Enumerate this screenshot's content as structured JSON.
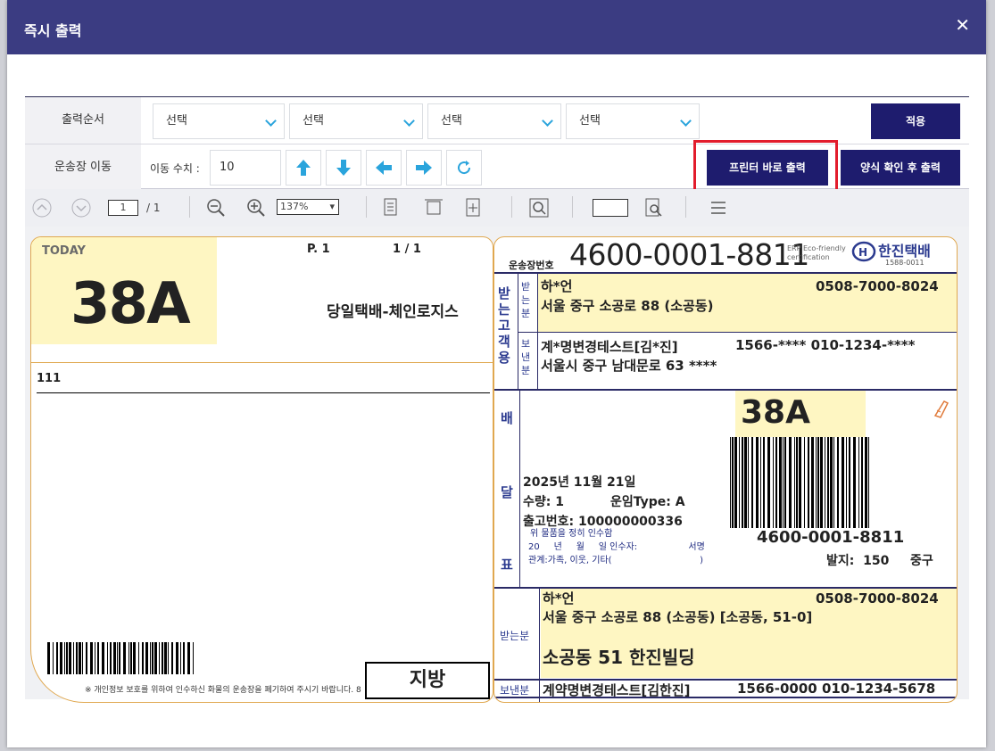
{
  "dialog": {
    "title": "즉시 출력"
  },
  "options": {
    "order_label": "출력순서",
    "selects": [
      "선택",
      "선택",
      "선택",
      "선택"
    ],
    "apply_button": "적용",
    "move_label": "운송장 이동",
    "move_amount_label": "이동 수치 :",
    "move_amount_value": "10",
    "print_direct_button": "프린터 바로 출력",
    "print_preview_button": "양식 확인 후 출력"
  },
  "viewer": {
    "page_current": "1",
    "page_total": "/ 1",
    "zoom": "137%"
  },
  "waybill": {
    "today_label": "TODAY",
    "sort_code": "38A",
    "page_label": "P. 1",
    "page_count": "1 / 1",
    "service_name": "당일택배-체인로지스",
    "memo": "111",
    "privacy_notice": "※ 개인정보 보호를 위하여 인수하신 화물의 운송장을 폐기하여 주시기 바랍니다. 8",
    "region_box": "지방",
    "waybill_no_label": "운송장번호",
    "waybill_no": "4600-0001-8811",
    "eco_text": "ERP Eco-friendly certification",
    "brand_name": "한진택배",
    "brand_phone": "1588-0011",
    "customer_col": "받는고객용",
    "receiver_col": "받는분",
    "sender_col": "보낸분",
    "receiver_name": "하*언",
    "receiver_phone": "0508-7000-8024",
    "receiver_addr": "서울 중구 소공로 88 (소공동)",
    "sender_name": "계*명변경테스트[김*진]",
    "sender_phones": "1566-**** 010-1234-****",
    "sender_addr": "서울시 중구 남대문로 63 ****",
    "delivery_col": [
      "배",
      "달",
      "표"
    ],
    "date": "2025년 11월 21일",
    "qty": "수량: 1",
    "fare_type": "운임Type: A",
    "release_no": "출고번호: 100000000336",
    "receipt_line1": "위 물품을 정히 인수함",
    "receipt_line2": "20     년     월     일 인수자:                  서명",
    "receipt_line3": "관계:가족, 이웃, 기타(                               )",
    "barcode_no": "4600-0001-8811",
    "origin": "발지:  150",
    "district": "중구",
    "bottom_receiver_label": "받는분",
    "bottom_receiver_name": "하*언",
    "bottom_receiver_phone": "0508-7000-8024",
    "bottom_receiver_addr": "서울 중구 소공로 88 (소공동) [소공동, 51-0]",
    "bottom_building": "소공동 51 한진빌딩",
    "bottom_sender_label": "보낸분",
    "bottom_sender": "계약명변경테스트[김한진]",
    "bottom_sender_phones": "1566-0000 010-1234-5678"
  },
  "colors": {
    "titlebar": "#3b3c82",
    "navy_button": "#1e1c6e",
    "highlight": "#e21c2c",
    "label_yellow": "#fef6c2",
    "arrow_blue": "#2aa4dc"
  }
}
